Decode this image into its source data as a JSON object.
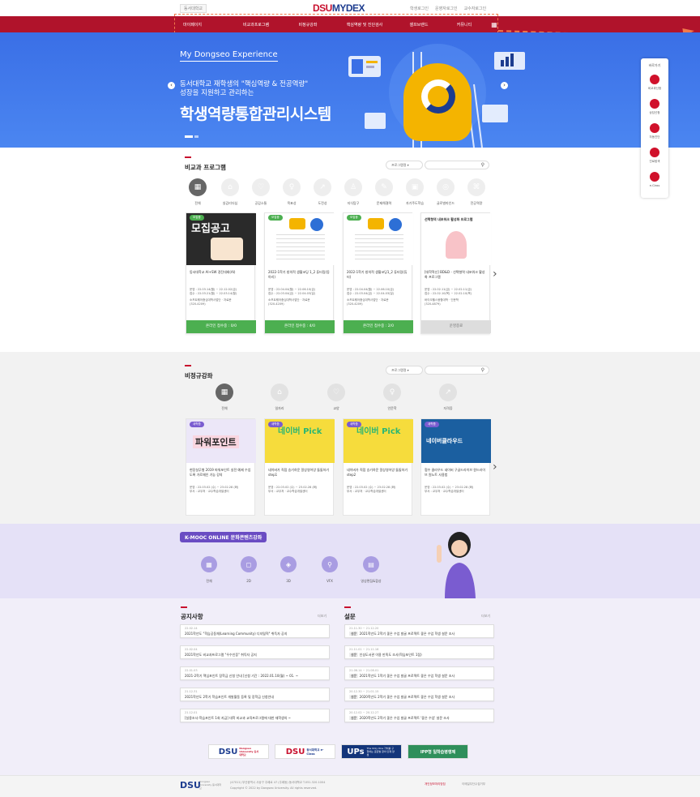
{
  "header": {
    "home_btn": "동서대학교",
    "logo_a": "DSU",
    "logo_b": "MYDEX",
    "links": [
      "학생로그인",
      "운영자로그인",
      "교수자로그인"
    ]
  },
  "gnb": {
    "items": [
      "마이페이지",
      "비교과프로그램",
      "비정규강좌",
      "핵심역량 및 진단검사",
      "셀프브랜드",
      "커뮤니티"
    ],
    "menu_icon": "grid-icon"
  },
  "hero": {
    "tag": "My Dongseo Experience",
    "sub1": "동서대학교 재학생의 \"핵심역량 & 전공역량\"",
    "sub2": "성장을 지원하고 관리하는",
    "title": "학생역량통합관리시스템"
  },
  "side_panel": {
    "title": "바로가기",
    "items": [
      {
        "label": "비교과신청",
        "icon": "pen-icon"
      },
      {
        "label": "상담신청",
        "icon": "chat-icon"
      },
      {
        "label": "자동진단",
        "icon": "heart-icon"
      },
      {
        "label": "진로탐색",
        "icon": "chart-icon"
      },
      {
        "label": "e-Class",
        "icon": "monitor-icon"
      }
    ]
  },
  "program": {
    "title": "비교과 프로그램",
    "select": "프로그램명",
    "search_icon": "search-icon",
    "categories": [
      "전체",
      "실감리더십",
      "공감소통",
      "목표성",
      "도전성",
      "지식탐구",
      "문제해결력",
      "자기주도학습",
      "글로벌마인드",
      "전공역량"
    ],
    "cards": [
      {
        "badge": "모집중",
        "img_text": "모집공고",
        "title": "동서대학교 AI+SW 경진대회(AI)",
        "info1": "운영 : 22.03.14(월) ~ 22.12.02(금)",
        "info2": "접수 : 22.03.21(월) ~ 22.03.14(월)",
        "info3": "소프트웨어중심대학사업단 · 자료문",
        "info4": "(320-4209)",
        "btn": "온라인 접수중 : 0/0"
      },
      {
        "badge": "모집중",
        "img_text": "",
        "title": "2022-1학기 창의적 생활코딩 1_2 튜터링(동아리)",
        "info1": "운영 : 22.04.04(월) ~ 22.06.10(금)",
        "info2": "접수 : 22.03.04(금) ~ 22.04.03(일)",
        "info3": "소프트웨어중심대학사업단 · 자료문",
        "info4": "(320-4209)",
        "btn": "온라인 접수중 : 4/0"
      },
      {
        "badge": "모집중",
        "img_text": "",
        "title": "2022-1학기 창의적 생활코딩1_2 튜터링(튜터)",
        "info1": "운영 : 22.04.04(월) ~ 22.06.10(금)",
        "info2": "접수 : 22.03.04(금) ~ 22.04.03(일)",
        "info3": "소프트웨어중심대학사업단 · 자료문",
        "info4": "(320-4209)",
        "btn": "온라인 접수중 : 2/0"
      },
      {
        "badge": "",
        "img_text": "선택형역 내포워크 활성화 프로그램",
        "title": "[대학혁신] BD&D - 선택형역 내포워크 활성화 프로그램",
        "info1": "운영 : 22.02.11(금) ~ 22.02.11(금)",
        "info2": "접수 : 22.02.10(목) ~ 22.02.10(목)",
        "info3": "바이오헬스융합대학 · 인문학",
        "info4": "(320-4879)",
        "btn": "운영종료"
      }
    ]
  },
  "course": {
    "title": "비정규강좌",
    "select": "프로그램명",
    "categories": [
      "전체",
      "일자리",
      "교양",
      "인문학",
      "자격증"
    ],
    "cards": [
      {
        "badge": "새학쯤",
        "img_text": "파워포인트",
        "title": "현장실무형 2019 파워포인트 실전 예제 수업도록 가로재인 기능 강의",
        "info1": "운영 : 22.03.02 (수) ~ 23.02.28 (화)",
        "info2": "부서 : 교무처 · 교수학습개발센터"
      },
      {
        "badge": "새학쯤",
        "img_text": "네이버 Pick",
        "title": "네이버가 직접 승기하운 알상영어앙 똘똘하기 step1",
        "info1": "운영 : 22.03.02 (수) ~ 23.02.28 (화)",
        "info2": "부서 : 교무처 · 교수학습개발센터"
      },
      {
        "badge": "새학쯤",
        "img_text": "네이버 Pick",
        "title": "네이버가 직접 승기하운 알상영어앙 똘똘하기 step2",
        "info1": "운영 : 22.03.02 (수) ~ 23.02.28 (화)",
        "info2": "부서 : 교무처 · 교수학습개발센터"
      },
      {
        "badge": "새학쯤",
        "img_text": "네이버클라우드",
        "title": "협수 클라우드 네이버 구글드라이브 원드라이브 원노트 사용법",
        "info1": "운영 : 22.03.02 (수) ~ 23.02.28 (화)",
        "info2": "부서 : 교무처 · 교수학습개발센터"
      }
    ]
  },
  "kcontent": {
    "badge": "K-MOOC ONLINE 문화콘텐츠강좌",
    "categories": [
      "전체",
      "2D",
      "3D",
      "VFX",
      "영상편집&합성"
    ]
  },
  "notice": {
    "title": "공지사항",
    "more": "더보기",
    "items": [
      {
        "date": "22.02.14",
        "text": "2021학년도 \"학습공동체(Learning Community) 디지털혁\" 취득자 공지"
      },
      {
        "date": "22.02.04",
        "text": "2021학년도 비교과프로그램 \"우수인증\" 취득자 공지"
      },
      {
        "date": "22.01.03",
        "text": "2021-2학기 핵심포인트 장학금 신청 안내 [신청 기간 : 2022.01.10(월) ~ 01. ~"
      },
      {
        "date": "21.12.31",
        "text": "2021학년도 2학기 학습포인트 개발활동 등록 및 장학금 신청안내"
      },
      {
        "date": "21.12.01",
        "text": "[실용조사-학습포인트 1회 지급] 대학 비교과 교육프로그램에 대한 재학생의 ~"
      }
    ]
  },
  "survey": {
    "title": "설문",
    "more": "더보기",
    "items": [
      {
        "date": "21.11.30 ~ 21.12.20",
        "tag": "설문",
        "text": "2021학년도 2학기 좋은 수업 발굴 프로젝트 좋은 수업 학생 설문 조사"
      },
      {
        "date": "21.11.01 ~ 21.11.16",
        "tag": "설문",
        "text": "인성도서관 이용 만족도 조사(학습포인트 1점)"
      },
      {
        "date": "21.06.14 ~ 21.08.01",
        "tag": "설문",
        "text": "2021학년도 1학기 좋은 수업 발굴 프로젝트 좋은 수업 학생 설문 조사"
      },
      {
        "date": "20.12.30 ~ 21.01.15",
        "tag": "설문",
        "text": "2020학년도 2학기 좋은 수업 발굴 프로젝트 좋은 수업 학생 설문 조사"
      },
      {
        "date": "20.12.02 ~ 20.12.27",
        "tag": "설문",
        "text": "2020학년도 2학기 좋은 수업 발굴 프로젝트 '좋은 수업' 설문 조사"
      }
    ]
  },
  "banners": [
    {
      "main": "DSU",
      "sub": "Dongseo University 동서대학교"
    },
    {
      "main": "DSU",
      "sub": "동서대학교 e-Class"
    },
    {
      "main": "UPs",
      "sub": "The Only One 가치를 구현하는 글로벌 창의 인재 양성"
    },
    {
      "main": "IPP형 일학습병행제",
      "sub": ""
    }
  ],
  "footer": {
    "logo": "DSU",
    "logo_sub": "Dongseo University 동서대학교",
    "addr": "(47011) 부산광역시 사상구 주례로 47 (주례동) 동서대학교 T.051.320.1004",
    "copy": "Copyright © 2022 by Dongseo University. All rights reserved.",
    "link1": "개인정보처리방침",
    "link2": "이메일무단수집거부"
  },
  "colors": {
    "brand_red": "#b0132b",
    "hero_blue": "#3a6fe6",
    "green": "#4caf50",
    "purple": "#6a4cc3"
  }
}
